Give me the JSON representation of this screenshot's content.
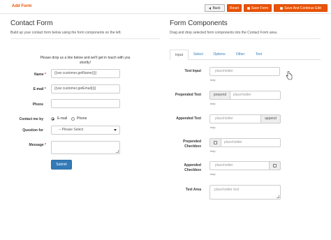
{
  "toolbar": {
    "page_title": "Add Form",
    "back_label": "Back",
    "reset_label": "Reset",
    "save_label": "Save Form",
    "save_continue_label": "Save And Continue Edit",
    "accent": "#eb5202"
  },
  "contact_form": {
    "title": "Contact Form",
    "subtitle": "Build up your contact form below using the form components on the left.",
    "intro": "Please drop us a line below and we'll get in touch with you shortly!",
    "fields": {
      "name": {
        "label": "Name",
        "required_mark": "*",
        "value": "{{var customer.getName()}}"
      },
      "email": {
        "label": "E-mail",
        "required_mark": "*",
        "value": "{{var customer.getEmail()}}"
      },
      "phone": {
        "label": "Phone",
        "value": ""
      },
      "contact_me_by": {
        "label": "Contact me by",
        "options": [
          "E-mail",
          "Phone"
        ],
        "selected": "E-mail"
      },
      "question_for": {
        "label": "Question for",
        "selected": "-- Please Select"
      },
      "message": {
        "label": "Message",
        "required_mark": "*",
        "value": ""
      }
    },
    "submit_label": "Submit",
    "submit_color": "#337ab7"
  },
  "components": {
    "title": "Form Components",
    "subtitle": "Drag and drop selected form components into the Contact Form area.",
    "tabs": [
      {
        "label": "Input",
        "active": true
      },
      {
        "label": "Select",
        "active": false
      },
      {
        "label": "Options",
        "active": false
      },
      {
        "label": "Other",
        "active": false
      },
      {
        "label": "Text",
        "active": false
      }
    ],
    "items": {
      "text_input": {
        "label": "Text Input",
        "placeholder": "placeholder",
        "help": "help"
      },
      "prepended_text": {
        "label": "Prepended Text",
        "addon": "prepend",
        "placeholder": "placeholder",
        "help": "help"
      },
      "appended_text": {
        "label": "Appended Text",
        "addon": "append",
        "placeholder": "placeholder",
        "help": "help"
      },
      "prepended_checkbox": {
        "label_line1": "Prepended",
        "label_line2": "Checkbox",
        "placeholder": "placeholder",
        "help": "help"
      },
      "appended_checkbox": {
        "label_line1": "Appended",
        "label_line2": "Checkbox",
        "placeholder": "placeholder",
        "help": "help"
      },
      "text_area": {
        "label": "Text Area",
        "placeholder": "placeholder text"
      }
    }
  }
}
